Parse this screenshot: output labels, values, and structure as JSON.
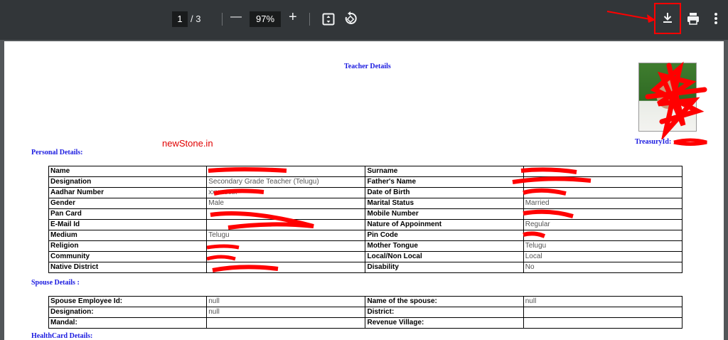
{
  "toolbar": {
    "page_current": "1",
    "page_total": "/ 3",
    "zoom": "97%",
    "minus": "—",
    "plus": "+"
  },
  "document": {
    "title": "Teacher Details",
    "watermark": "newStone.in",
    "treasury_label": "TreasuryId:",
    "personal_heading": "Personal Details:",
    "spouse_heading": "Spouse   Details :",
    "healthcard_heading": "HealthCard Details:",
    "personal_rows": [
      {
        "l1": "Name",
        "v1": "",
        "l2": "Surname",
        "v2": ""
      },
      {
        "l1": "Designation",
        "v1": "Secondary Grade Teacher (Telugu)",
        "l2": "Father's Name",
        "v2": ""
      },
      {
        "l1": "Aadhar Number",
        "v1": "xxxxxxxx",
        "l2": "Date of Birth",
        "v2": ""
      },
      {
        "l1": "Gender",
        "v1": "Male",
        "l2": "Marital Status",
        "v2": "Married"
      },
      {
        "l1": "Pan Card",
        "v1": "",
        "l2": "Mobile Number",
        "v2": ""
      },
      {
        "l1": "E-Mail Id",
        "v1": "",
        "l2": "Nature of Appoinment",
        "v2": "Regular"
      },
      {
        "l1": "Medium",
        "v1": "Telugu",
        "l2": "Pin Code",
        "v2": ""
      },
      {
        "l1": "Religion",
        "v1": "",
        "l2": "Mother Tongue",
        "v2": "Telugu"
      },
      {
        "l1": "Community",
        "v1": "",
        "l2": "Local/Non Local",
        "v2": "Local"
      },
      {
        "l1": "Native District",
        "v1": "",
        "l2": "Disability",
        "v2": "No"
      }
    ],
    "spouse_rows": [
      {
        "l1": "Spouse Employee Id:",
        "v1": "null",
        "l2": "Name of the spouse:",
        "v2": "null"
      },
      {
        "l1": "Designation:",
        "v1": "null",
        "l2": "District:",
        "v2": ""
      },
      {
        "l1": "Mandal:",
        "v1": "",
        "l2": "Revenue Village:",
        "v2": ""
      }
    ]
  },
  "colors": {
    "heading_blue": "#1a1ae0",
    "annotation_red": "#ff0000",
    "toolbar_bg": "#323639"
  }
}
